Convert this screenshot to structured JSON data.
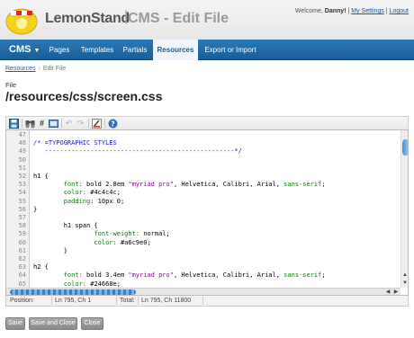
{
  "header": {
    "brand": "LemonStand",
    "page_heading": "CMS - Edit File",
    "welcome_prefix": "Welcome, ",
    "user_name": "Danny!",
    "separator": "|",
    "my_settings": "My Settings",
    "logout": "Logout"
  },
  "nav": {
    "module": "CMS",
    "items": [
      {
        "label": "Pages",
        "active": false
      },
      {
        "label": "Templates",
        "active": false
      },
      {
        "label": "Partials",
        "active": false
      },
      {
        "label": "Resources",
        "active": true
      },
      {
        "label": "Export or Import",
        "active": false
      }
    ]
  },
  "breadcrumb": {
    "root": "Resources",
    "current": "Edit File"
  },
  "file": {
    "label": "File",
    "path": "/resources/css/screen.css"
  },
  "toolbar": {
    "icons": [
      "save-icon",
      "search-icon",
      "line-number-icon",
      "fullscreen-icon",
      "undo-icon",
      "redo-icon",
      "highlight-toggle-icon",
      "help-icon"
    ]
  },
  "editor": {
    "lines": [
      {
        "num": "47",
        "text": ""
      },
      {
        "num": "48",
        "text": "/* =TYPOGRAPHIC STYLES",
        "kind": "comment"
      },
      {
        "num": "49",
        "text": "   --------------------------------------------------*/",
        "kind": "comment"
      },
      {
        "num": "50",
        "text": ""
      },
      {
        "num": "51",
        "text": ""
      },
      {
        "num": "52",
        "text": "h1 {"
      },
      {
        "num": "53",
        "indent": "        ",
        "key": "font:",
        "value": " bold 2.8em ",
        "str": "\"myriad pro\"",
        "rest": ", Helvetica, Calibri, Arial, ",
        "tail": "sans-serif",
        "end": ";"
      },
      {
        "num": "54",
        "indent": "        ",
        "key": "color:",
        "value": " #4c4c4c;"
      },
      {
        "num": "55",
        "indent": "        ",
        "key": "padding:",
        "value": " 10px 0;"
      },
      {
        "num": "56",
        "text": "}"
      },
      {
        "num": "57",
        "text": ""
      },
      {
        "num": "58",
        "text": "        h1 span {"
      },
      {
        "num": "59",
        "indent": "                ",
        "key": "font-weight:",
        "value": " normal;"
      },
      {
        "num": "60",
        "indent": "                ",
        "key": "color:",
        "value": " #a6c9e0;"
      },
      {
        "num": "61",
        "text": "        }"
      },
      {
        "num": "62",
        "text": ""
      },
      {
        "num": "63",
        "text": "h2 {"
      },
      {
        "num": "64",
        "indent": "        ",
        "key": "font:",
        "value": " bold 3.4em ",
        "str": "\"myriad pro\"",
        "rest": ", Helvetica, Calibri, Arial, ",
        "tail": "sans-serif",
        "end": ";"
      },
      {
        "num": "65",
        "indent": "        ",
        "key": "color:",
        "value": " #24668e;"
      }
    ]
  },
  "status": {
    "position_label": "Position:",
    "position_value": "Ln 795, Ch 1",
    "total_label": "Total:",
    "total_value": "Ln 795, Ch 11800"
  },
  "actions": {
    "save": "Save",
    "save_close": "Save and Close",
    "close": "Close"
  },
  "colors": {
    "nav_bg": "#1b5e95",
    "comment": "#1a1ac0",
    "keyword": "#0a7a0a",
    "string": "#8a0a8a"
  }
}
